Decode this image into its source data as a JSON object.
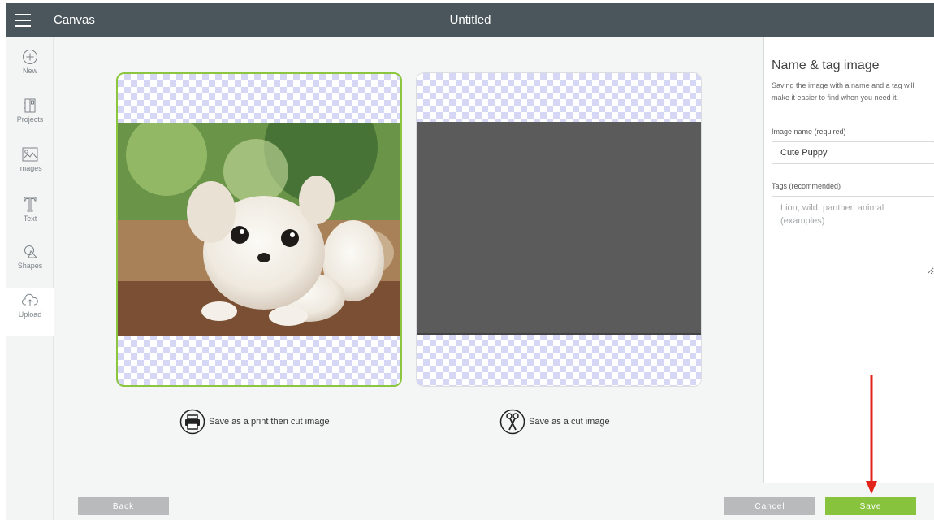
{
  "topbar": {
    "app_name": "Canvas",
    "doc_title": "Untitled"
  },
  "sidebar": {
    "items": [
      {
        "label": "New",
        "icon": "plus-circle-icon"
      },
      {
        "label": "Projects",
        "icon": "projects-icon"
      },
      {
        "label": "Images",
        "icon": "images-icon"
      },
      {
        "label": "Text",
        "icon": "text-icon"
      },
      {
        "label": "Shapes",
        "icon": "shapes-icon"
      },
      {
        "label": "Upload",
        "icon": "upload-cloud-icon",
        "active": true
      }
    ]
  },
  "options": {
    "print_then_cut": "Save as a print then cut image",
    "cut_only": "Save as a cut image"
  },
  "right_panel": {
    "title": "Name & tag image",
    "description": "Saving the image with a name and a tag will make it easier to find when you need it.",
    "name_label": "Image name (required)",
    "name_value": "Cute Puppy",
    "tags_label": "Tags (recommended)",
    "tags_placeholder": "Lion, wild, panther, animal (examples)"
  },
  "footer": {
    "back": "Back",
    "cancel": "Cancel",
    "save": "Save"
  },
  "colors": {
    "topbar": "#4b565c",
    "accent_green": "#87c33d",
    "gray_button": "#b9babc",
    "annotation_arrow": "#e2231a"
  }
}
